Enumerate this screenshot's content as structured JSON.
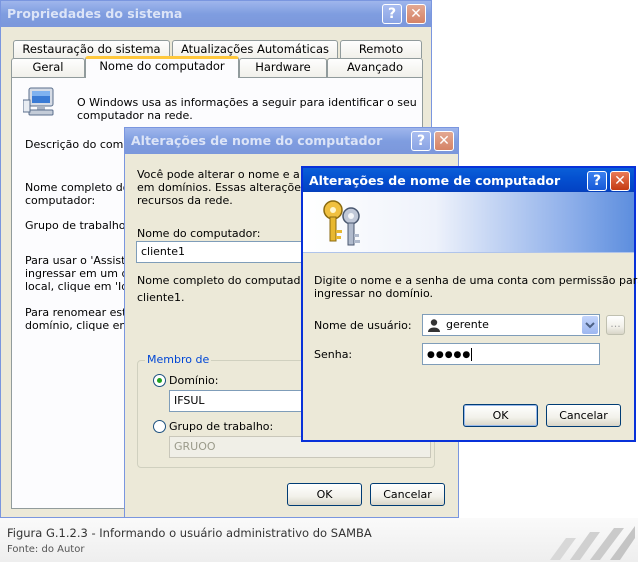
{
  "sysprops": {
    "title": "Propriedades do sistema",
    "tabs_row1": [
      "Restauração do sistema",
      "Atualizações Automáticas",
      "Remoto"
    ],
    "tabs_row2": [
      "Geral",
      "Nome do computador",
      "Hardware",
      "Avançado"
    ],
    "info_line1": "O Windows usa as informações a seguir para identificar o seu",
    "info_line2": "computador na rede.",
    "desc_label": "Descrição do compu",
    "fullname_label_1": "Nome completo do",
    "fullname_label_2": "computador:",
    "workgroup_label": "Grupo de trabalho:",
    "assist_1": "Para usar o 'Assiste",
    "assist_2": "ingressar em um dom",
    "assist_3": "local, clique em 'Iden",
    "rename_1": "Para renomear este",
    "rename_2": "domínio, clique em '"
  },
  "rename_dialog": {
    "title": "Alterações de nome do computador",
    "intro_1": "Você pode alterar o nome e a par",
    "intro_2": "em domínios. Essas alterações po",
    "intro_3": "recursos da rede.",
    "computer_name_label": "Nome do computador:",
    "computer_name_value": "cliente1",
    "full_name_label": "Nome completo do computador:",
    "full_name_value": "cliente1.",
    "member_of": "Membro de",
    "domain_label": "Domínio:",
    "domain_value": "IFSUL",
    "workgroup_label": "Grupo de trabalho:",
    "workgroup_value": "GRUOO",
    "ok": "OK",
    "cancel": "Cancelar"
  },
  "cred_dialog": {
    "title": "Alterações de nome de computador",
    "message_1": "Digite o nome e a senha de uma conta com permissão para",
    "message_2": "ingressar no domínio.",
    "username_label": "Nome de usuário:",
    "username_value": "gerente",
    "password_label": "Senha:",
    "password_value": "●●●●●",
    "browse_label": "...",
    "ok": "OK",
    "cancel": "Cancelar"
  },
  "caption": {
    "figure": "Figura G.1.2.3 - Informando o usuário administrativo do SAMBA",
    "source": "Fonte: do Autor"
  },
  "title_buttons": {
    "help": "?",
    "close": "✕"
  }
}
